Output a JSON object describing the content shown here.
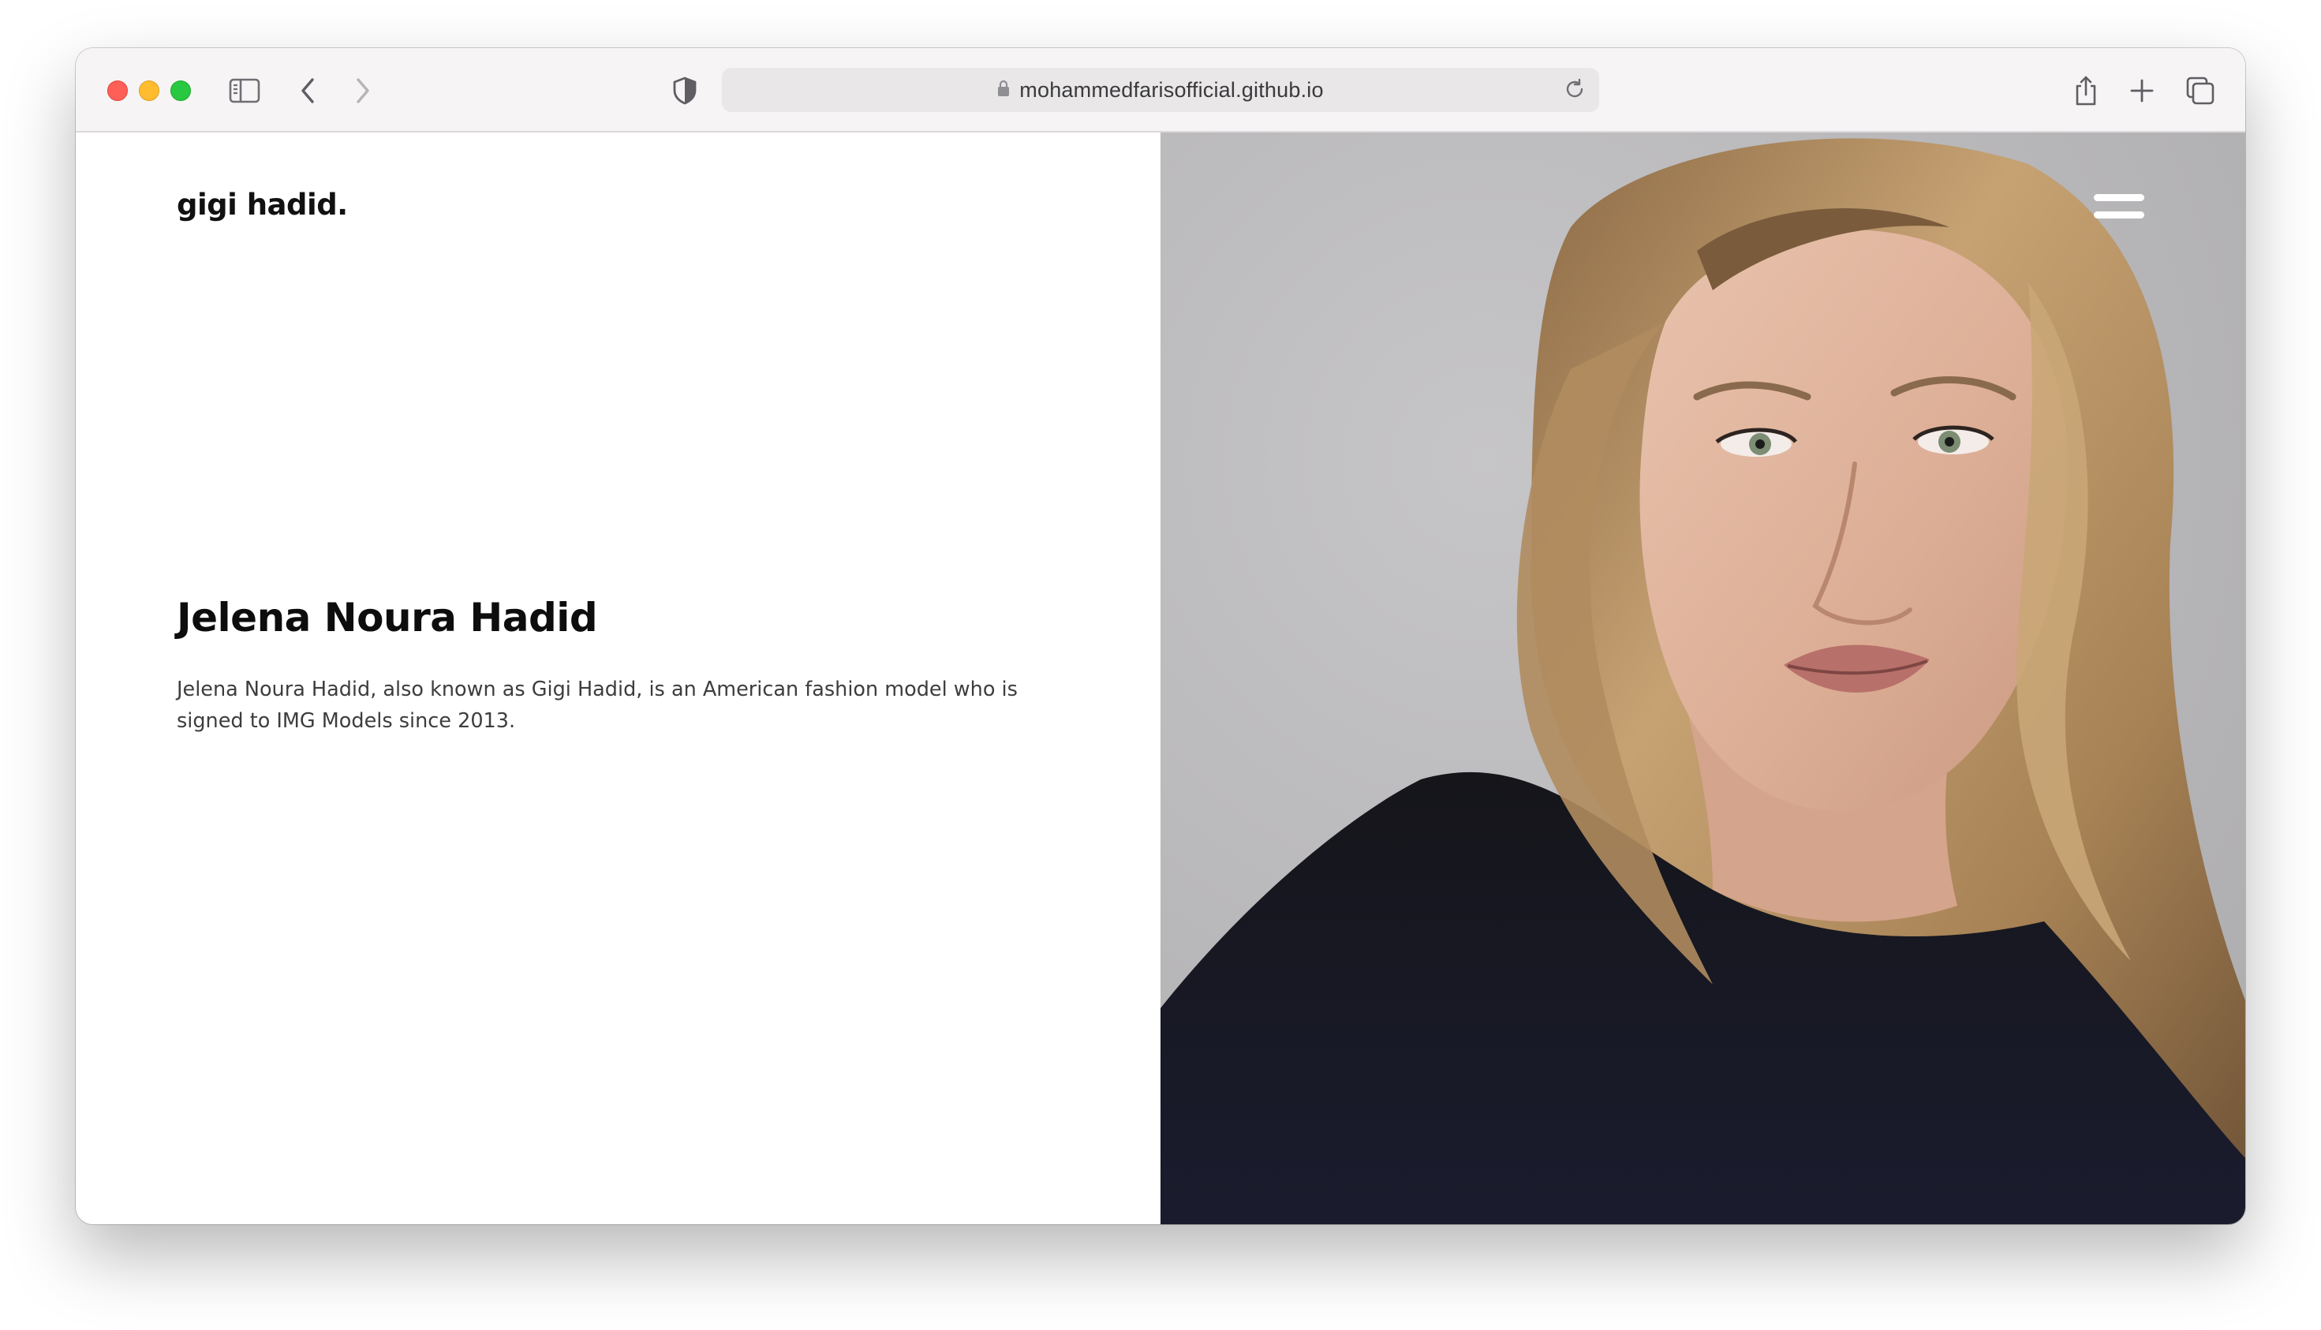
{
  "browser": {
    "url": "mohammedfarisofficial.github.io",
    "icons": [
      "sidebar-icon",
      "back-icon",
      "forward-icon",
      "shield-icon",
      "lock-icon",
      "reload-icon",
      "share-icon",
      "new-tab-icon",
      "tab-overview-icon"
    ]
  },
  "site": {
    "logo": "gigi hadid.",
    "headline": "Jelena Noura Hadid",
    "description": "Jelena Noura Hadid, also known as Gigi Hadid, is an American fashion model who is signed to IMG Models since 2013."
  },
  "hero": {
    "menu_icon": "hamburger-menu-icon"
  }
}
